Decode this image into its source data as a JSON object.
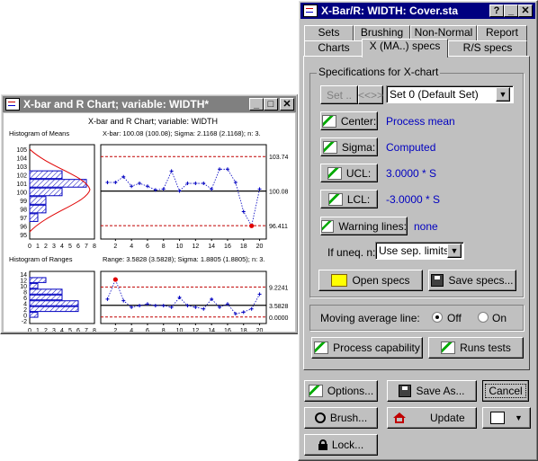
{
  "chart_window": {
    "title": "X-bar and R Chart; variable:  WIDTH*",
    "header": "X-bar and R Chart; variable:  WIDTH",
    "hist_means_title": "Histogram of Means",
    "xbar_stats": "X-bar: 100.08 (100.08); Sigma: 2.1168 (2.1168); n: 3.",
    "hist_ranges_title": "Histogram of Ranges",
    "range_stats": "Range: 3.5828 (3.5828); Sigma: 1.8805 (1.8805); n: 3.",
    "means_y_ticks": [
      "105",
      "104",
      "103",
      "102",
      "101",
      "100",
      "99",
      "98",
      "97",
      "96",
      "95"
    ],
    "means_x_ticks": [
      "0",
      "1",
      "2",
      "3",
      "4",
      "5",
      "6",
      "7",
      "8"
    ],
    "ranges_y_ticks": [
      "14",
      "12",
      "10",
      "8",
      "6",
      "4",
      "2",
      "0",
      "-2"
    ],
    "ranges_x_ticks": [
      "0",
      "1",
      "2",
      "3",
      "4",
      "5",
      "6",
      "7",
      "8"
    ],
    "sample_ticks": [
      "2",
      "4",
      "6",
      "8",
      "10",
      "12",
      "14",
      "16",
      "18",
      "20"
    ],
    "xbar_limits": {
      "ucl": "103.74",
      "center": "100.08",
      "lcl": "96.411"
    },
    "range_limits": {
      "ucl": "9.2241",
      "center": "3.5828",
      "lcl": "0.0000"
    }
  },
  "chart_data": [
    {
      "type": "line",
      "title": "X-bar",
      "x": [
        1,
        2,
        3,
        4,
        5,
        6,
        7,
        8,
        9,
        10,
        11,
        12,
        13,
        14,
        15,
        16,
        17,
        18,
        19,
        20
      ],
      "values": [
        101.0,
        101.0,
        101.6,
        100.6,
        100.9,
        100.6,
        100.2,
        100.3,
        102.2,
        100.1,
        100.9,
        100.9,
        100.9,
        100.3,
        102.4,
        102.4,
        101.0,
        97.9,
        96.4,
        100.3
      ],
      "ylim": [
        95,
        105
      ],
      "limits": {
        "ucl": 103.74,
        "center": 100.08,
        "lcl": 96.411
      },
      "out_of_control": [
        19
      ]
    },
    {
      "type": "line",
      "title": "Range",
      "x": [
        1,
        2,
        3,
        4,
        5,
        6,
        7,
        8,
        9,
        10,
        11,
        12,
        13,
        14,
        15,
        16,
        17,
        18,
        19,
        20
      ],
      "values": [
        5.5,
        11.5,
        5.0,
        3.0,
        3.5,
        4.0,
        3.5,
        3.5,
        3.0,
        6.0,
        3.5,
        3.0,
        2.5,
        5.5,
        3.0,
        4.0,
        1.0,
        1.5,
        2.5,
        7.0
      ],
      "ylim": [
        -2,
        14
      ],
      "limits": {
        "ucl": 9.2241,
        "center": 3.5828,
        "lcl": 0.0
      },
      "out_of_control": [
        2
      ]
    },
    {
      "type": "bar",
      "title": "Histogram of Means",
      "categories": [
        "105",
        "104",
        "103",
        "102",
        "101",
        "100",
        "99",
        "98",
        "97",
        "96"
      ],
      "values": [
        0,
        0,
        0,
        4,
        7,
        4,
        2,
        2,
        1,
        0
      ]
    },
    {
      "type": "bar",
      "title": "Histogram of Ranges",
      "categories": [
        "14",
        "12",
        "10",
        "8",
        "6",
        "4",
        "2",
        "0"
      ],
      "values": [
        0,
        2,
        1,
        4,
        4,
        6,
        6,
        1
      ]
    }
  ],
  "dialog": {
    "title": "X-Bar/R: WIDTH: Cover.sta",
    "tabs_row1": [
      "Sets",
      "Brushing",
      "Non-Normal",
      "Report"
    ],
    "tabs_row2": [
      "Charts",
      "X (MA..) specs",
      "R/S specs"
    ],
    "group_title": "Specifications for X-chart",
    "set_label": "Set",
    "set_value": "Set 0 (Default Set)",
    "center_label": "Center:",
    "center_value": "Process mean",
    "sigma_label": "Sigma:",
    "sigma_value": "Computed",
    "ucl_label": "UCL:",
    "ucl_value": "3.0000 * S",
    "lcl_label": "LCL:",
    "lcl_value": "-3.0000 * S",
    "warning_label": "Warning lines:",
    "warning_value": "none",
    "unequal_label": "If uneq. n:",
    "unequal_value": "Use sep. limits",
    "open_specs": "Open specs",
    "save_specs": "Save specs...",
    "ma_label": "Moving average line:",
    "ma_off": "Off",
    "ma_on": "On",
    "process_capability": "Process capability",
    "runs_tests": "Runs tests",
    "options": "Options...",
    "save_as": "Save As...",
    "cancel": "Cancel",
    "brush": "Brush...",
    "update": "Update",
    "lock": "Lock..."
  }
}
